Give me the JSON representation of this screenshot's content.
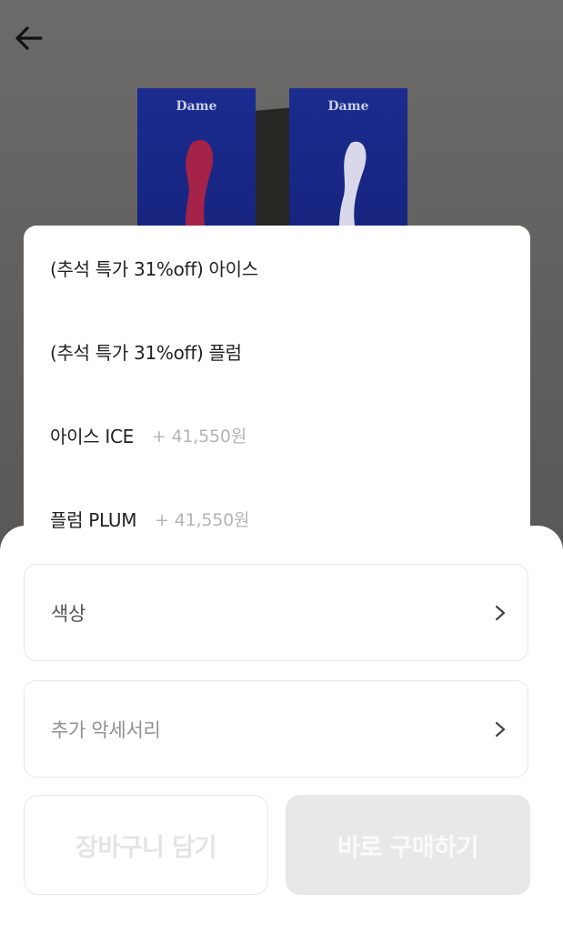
{
  "header": {
    "back_icon": "arrow-left-icon"
  },
  "hero": {
    "brand_left": "Dame",
    "brand_right": "Dame",
    "colors": {
      "box": "#1b2c8f",
      "plum": "#b8234a",
      "ice": "#e7e4f2"
    }
  },
  "options": [
    {
      "label": "(추석 특가 31%off) 아이스",
      "price": ""
    },
    {
      "label": "(추석 특가 31%off) 플럼",
      "price": ""
    },
    {
      "label": "아이스 ICE",
      "price": "+ 41,550원"
    },
    {
      "label": "플럼 PLUM",
      "price": "+ 41,550원"
    }
  ],
  "fields": {
    "color_label": "색상",
    "accessory_label": "추가 악세서리",
    "chevron_icon": "chevron-right-icon"
  },
  "actions": {
    "cart_label": "장바구니 담기",
    "buy_label": "바로 구매하기"
  }
}
